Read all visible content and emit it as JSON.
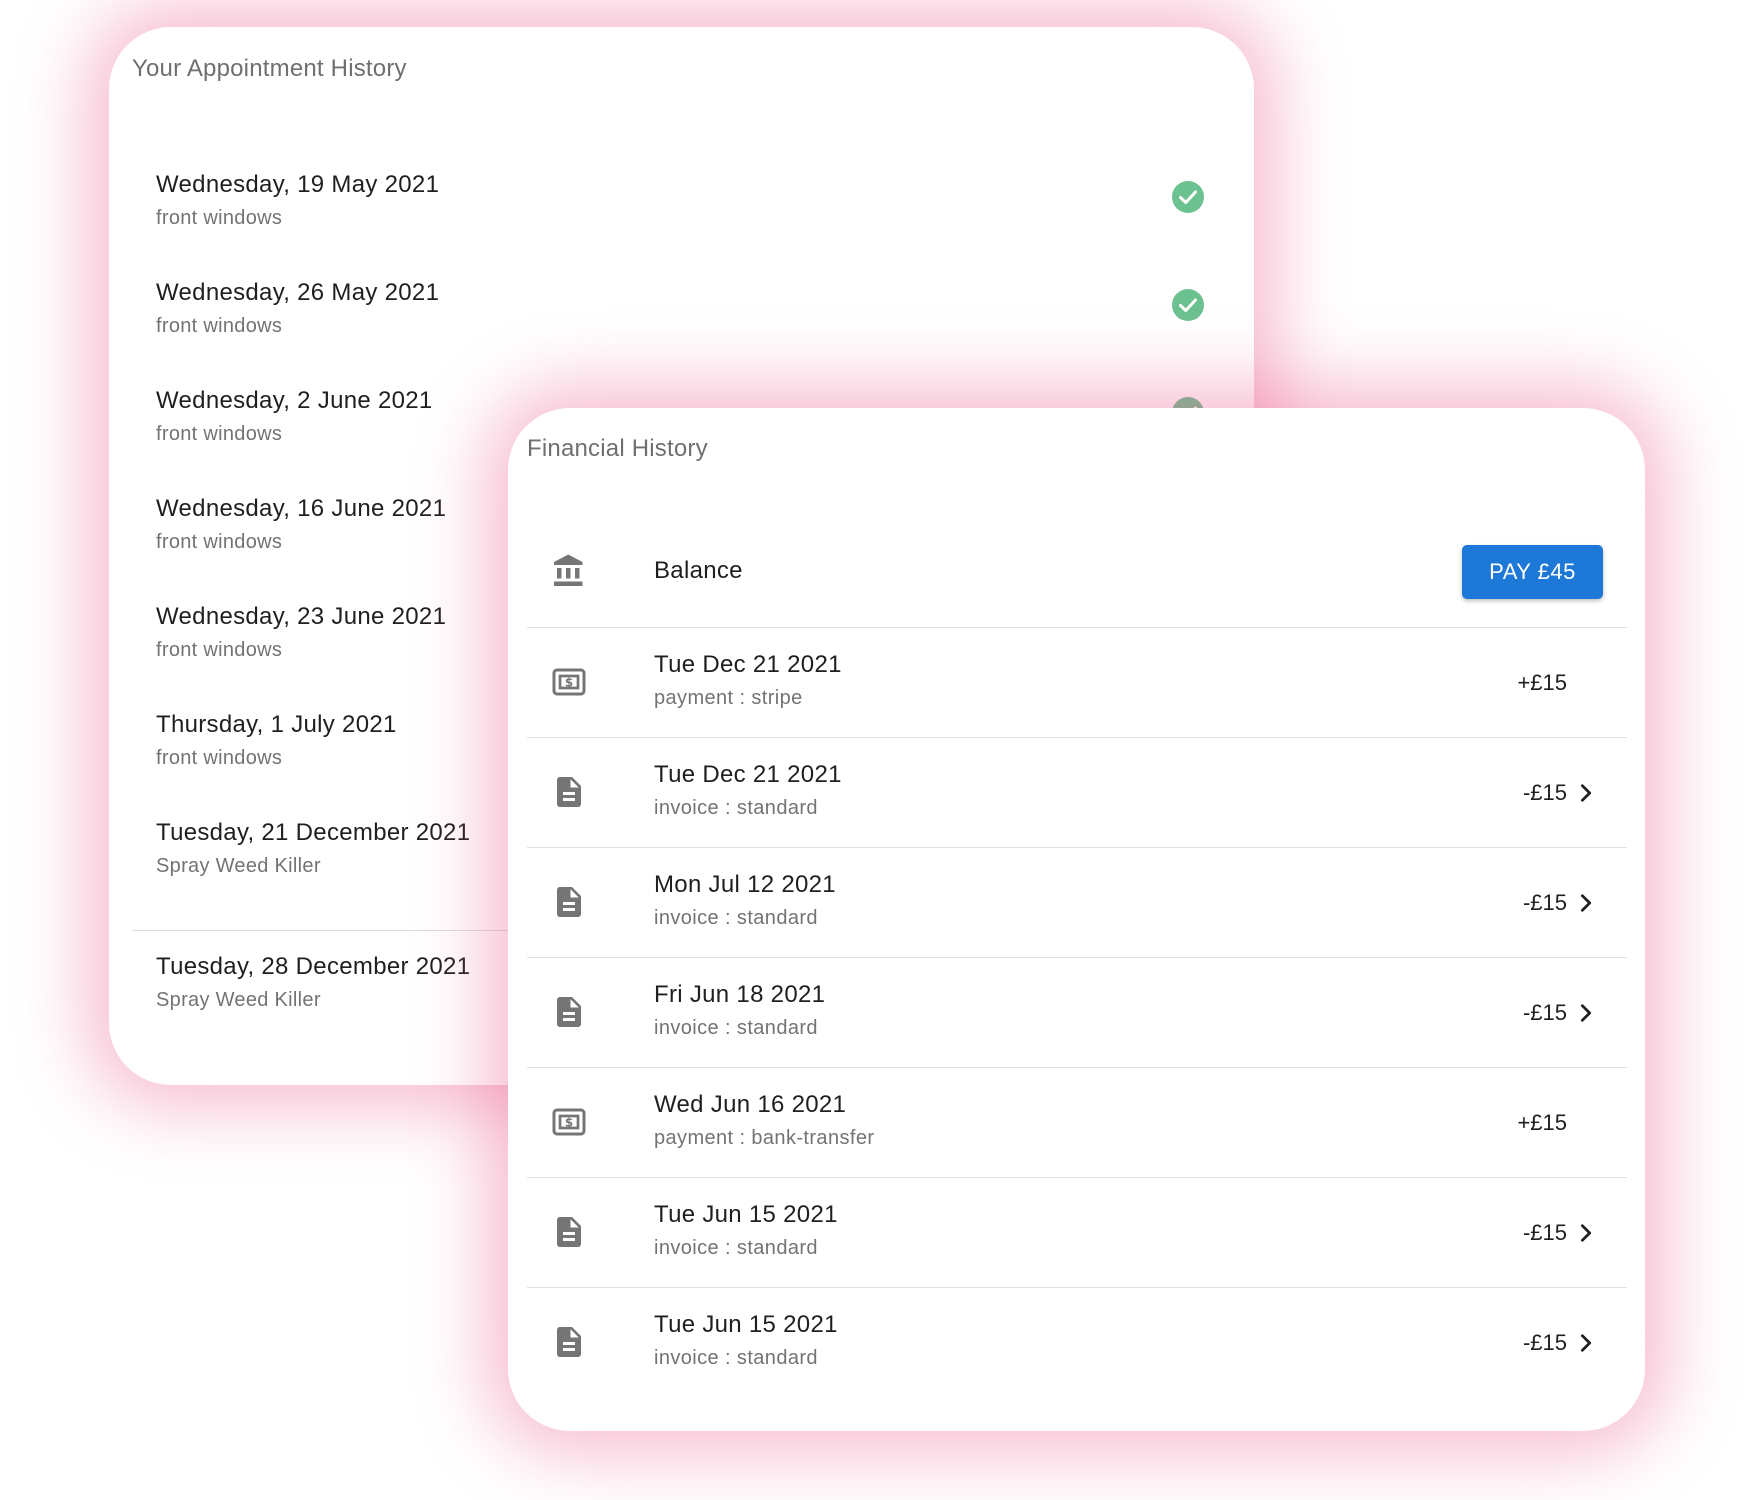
{
  "appointment_history": {
    "title": "Your Appointment History",
    "items": [
      {
        "date": "Wednesday, 19 May 2021",
        "service": "front windows",
        "status": "completed"
      },
      {
        "date": "Wednesday, 26 May 2021",
        "service": "front windows",
        "status": "completed"
      },
      {
        "date": "Wednesday, 2 June 2021",
        "service": "front windows",
        "status": "completed"
      },
      {
        "date": "Wednesday, 16 June 2021",
        "service": "front windows"
      },
      {
        "date": "Wednesday, 23 June 2021",
        "service": "front windows"
      },
      {
        "date": "Thursday, 1 July 2021",
        "service": "front windows"
      },
      {
        "date": "Tuesday, 21 December 2021",
        "service": "Spray Weed Killer"
      },
      {
        "date": "Tuesday, 28 December 2021",
        "service": "Spray Weed Killer"
      }
    ]
  },
  "financial_history": {
    "title": "Financial History",
    "balance": {
      "label": "Balance",
      "pay_button_label": "PAY £45",
      "icon": "bank-icon"
    },
    "transactions": [
      {
        "date": "Tue Dec 21 2021",
        "detail": "payment : stripe",
        "amount": "+£15",
        "icon": "cash-icon"
      },
      {
        "date": "Tue Dec 21 2021",
        "detail": "invoice : standard",
        "amount": "-£15",
        "icon": "document-icon"
      },
      {
        "date": "Mon Jul 12 2021",
        "detail": "invoice : standard",
        "amount": "-£15",
        "icon": "document-icon"
      },
      {
        "date": "Fri Jun 18 2021",
        "detail": "invoice : standard",
        "amount": "-£15",
        "icon": "document-icon"
      },
      {
        "date": "Wed Jun 16 2021",
        "detail": "payment : bank-transfer",
        "amount": "+£15",
        "icon": "cash-icon"
      },
      {
        "date": "Tue Jun 15 2021",
        "detail": "invoice : standard",
        "amount": "-£15",
        "icon": "document-icon"
      },
      {
        "date": "Tue Jun 15 2021",
        "detail": "invoice : standard",
        "amount": "-£15",
        "icon": "document-icon"
      }
    ]
  },
  "colors": {
    "accent": "#1e78d7",
    "success": "#6cc190",
    "icon_gray": "#757575",
    "glow": "#ec6092"
  }
}
